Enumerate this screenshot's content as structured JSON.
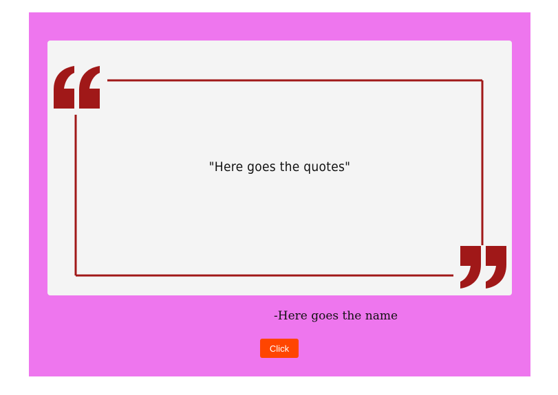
{
  "quote": {
    "text": "\"Here goes the quotes\"",
    "author": "-Here goes the name"
  },
  "button": {
    "label": "Click"
  },
  "icons": {
    "open_quote": "open-quote-icon",
    "close_quote": "close-quote-icon"
  },
  "colors": {
    "page_background": "#ffffff",
    "panel_background": "#ee76ee",
    "card_background": "#f4f4f4",
    "frame_color": "#a01818",
    "button_background": "#ff4500",
    "button_text": "#ffffff"
  }
}
